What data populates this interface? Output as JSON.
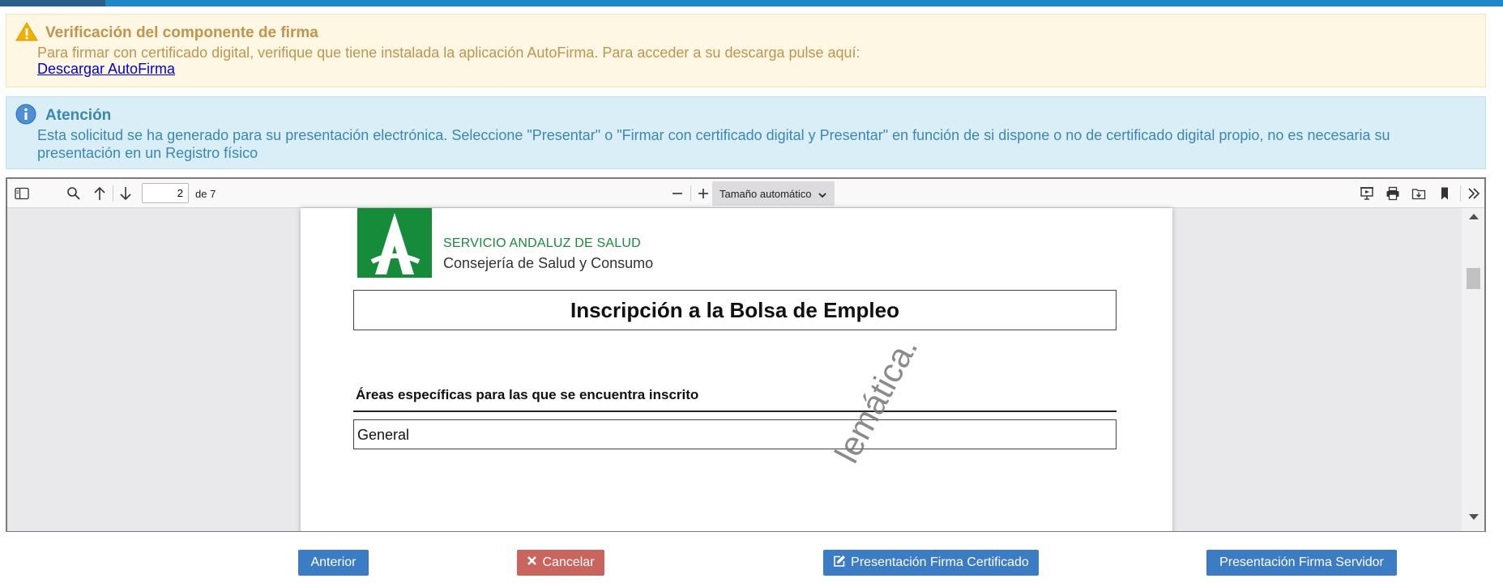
{
  "warning": {
    "title": "Verificación del componente de firma",
    "text": "Para firmar con certificado digital, verifique que tiene instalada la aplicación AutoFirma. Para acceder a su descarga pulse aquí:",
    "link": "Descargar AutoFirma",
    "icon": "warning-icon",
    "color": "#bf9550"
  },
  "info": {
    "title": "Atención",
    "text": "Esta solicitud se ha generado para su presentación electrónica. Seleccione \"Presentar\" o \"Firmar con certificado digital y Presentar\" en función de si dispone o no de certificado digital propio, no es necesaria su presentación en un Registro físico",
    "icon": "info-icon",
    "color": "#3b87b3"
  },
  "viewer": {
    "page_number": "2",
    "page_of": "de 7",
    "zoom": "Tamaño automático",
    "icons": [
      "sidebar-toggle-icon",
      "search-icon",
      "arrow-up-icon",
      "arrow-down-icon",
      "zoom-out-icon",
      "zoom-in-icon",
      "presentation-icon",
      "print-icon",
      "save-icon",
      "bookmark-icon",
      "double-chevron-icon"
    ]
  },
  "document": {
    "org_line1": "SERVICIO ANDALUZ DE SALUD",
    "org_line2": "Consejería de Salud y Consumo",
    "title": "Inscripción a la Bolsa de Empleo",
    "section_label": "Áreas específicas para las que se encuentra inscrito",
    "field_value": "General",
    "watermark": "lemática."
  },
  "buttons": {
    "previous": "Anterior",
    "cancel": "Cancelar",
    "certificate": "Presentación Firma Certificado",
    "server": "Presentación Firma Servidor"
  },
  "colors": {
    "topbar": "#1f87c6",
    "button_primary": "#3b7cc5",
    "button_danger": "#c9645f",
    "logo_green": "#168c3a"
  }
}
